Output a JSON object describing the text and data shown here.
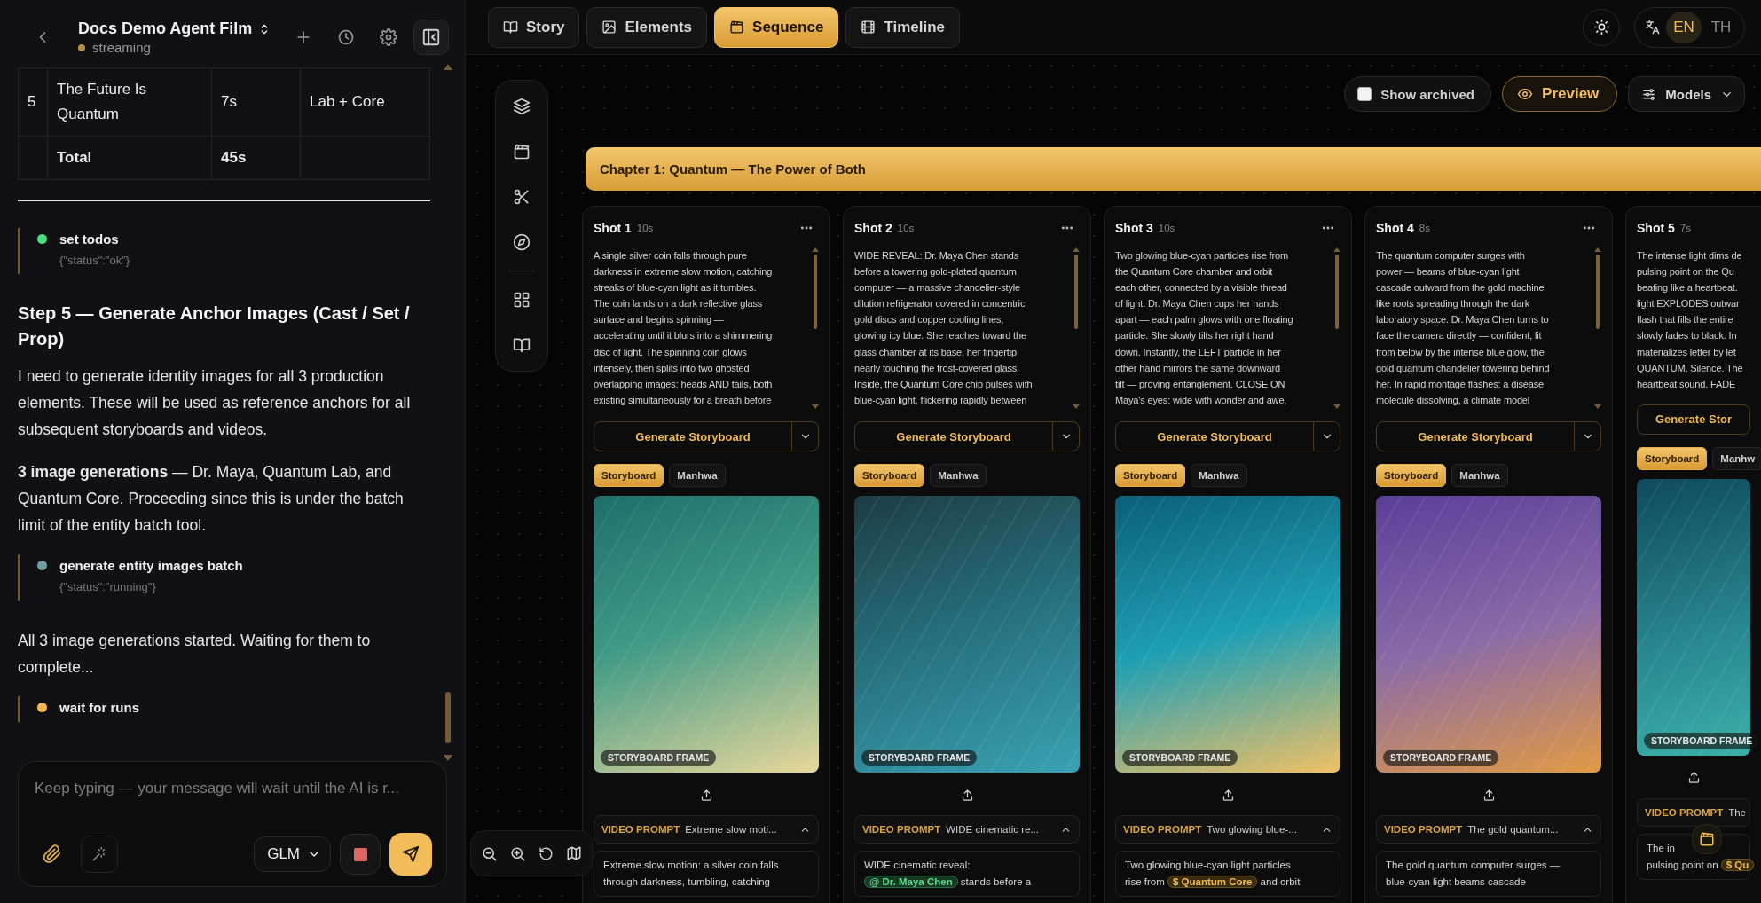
{
  "sidebar": {
    "title": "Docs Demo Agent Film",
    "status": "streaming",
    "table": {
      "rows": [
        {
          "kind": "normal",
          "column_1": "5",
          "column_2": "The Future Is Quantum",
          "column_3": "7s",
          "column_4": "Lab + Core"
        },
        {
          "kind": "total",
          "column_2": "Total",
          "column_3": "45s"
        }
      ]
    },
    "messages": [
      {
        "kind": "tool",
        "name": "set todos",
        "result": "{\"status\":\"ok\"}",
        "color": "#4ade80"
      },
      {
        "kind": "heading",
        "text": "Step 5 — Generate Anchor Images (Cast / Set / Prop)"
      },
      {
        "kind": "paragraph",
        "text": "I need to generate identity images for all 3 production elements. These will be used as reference anchors for all subsequent storyboards and videos."
      },
      {
        "kind": "paragraph",
        "text": "**3 image generations** — Dr. Maya, Quantum Lab, and Quantum Core. Proceeding since this is under the batch limit of the entity batch tool."
      },
      {
        "kind": "tool",
        "name": "generate entity images batch",
        "result": "{\"status\":\"running\"}",
        "color": "#6f9ea0"
      },
      {
        "kind": "paragraph",
        "text": "All 3 image generations started. Waiting for them to complete..."
      },
      {
        "kind": "tool",
        "name": "wait for runs",
        "color": "#f2b551"
      }
    ],
    "composer": {
      "placeholder": "Keep typing — your message will wait until the AI is r...",
      "model": "GLM"
    }
  },
  "tabs": [
    {
      "label": "Story",
      "selected": false
    },
    {
      "label": "Elements",
      "selected": false
    },
    {
      "label": "Sequence",
      "selected": true
    },
    {
      "label": "Timeline",
      "selected": false
    }
  ],
  "languages": [
    {
      "label": "EN",
      "selected": true
    },
    {
      "label": "TH",
      "selected": false
    }
  ],
  "controls": {
    "show_archived": {
      "label": "Show archived",
      "checked": false
    },
    "preview": "Preview",
    "models": "Models"
  },
  "chapter": {
    "title": "Chapter 1: Quantum — The Power of Both"
  },
  "shots": [
    {
      "title": "Shot 1",
      "duration": "10s",
      "more_menu": true,
      "description": "A single silver coin falls through pure\ndarkness in extreme slow motion, catching\nstreaks of blue-cyan light as it tumbles.\nThe coin lands on a dark reflective glass\nsurface and begins spinning —\naccelerating until it blurs into a shimmering\ndisc of light. The spinning coin glows\nintensely, then splits into two ghosted\noverlapping images: heads AND tails, both\nexisting simultaneously for a breath before",
      "generate": "Generate Storyboard",
      "modes": [
        {
          "label": "Storyboard",
          "selected": true
        },
        {
          "label": "Manhwa",
          "selected": false
        }
      ],
      "frame_label": "STORYBOARD FRAME",
      "prompt_label": "VIDEO PROMPT",
      "prompt_summary": "Extreme slow moti...",
      "prompt": [
        {
          "kind": "text",
          "text": "Extreme slow motion: a silver coin falls\nthrough darkness, tumbling, catching"
        }
      ]
    },
    {
      "title": "Shot 2",
      "duration": "10s",
      "more_menu": true,
      "description": "WIDE REVEAL: Dr. Maya Chen stands\nbefore a towering gold-plated quantum\ncomputer — a massive chandelier-style\ndilution refrigerator covered in concentric\ngold discs and copper cooling lines,\nglowing icy blue. She reaches toward the\nglass chamber at its base, her fingertip\nnearly touching the frost-covered glass.\nInside, the Quantum Core chip pulses with\nblue-cyan light, flickering rapidly between",
      "generate": "Generate Storyboard",
      "modes": [
        {
          "label": "Storyboard",
          "selected": true
        },
        {
          "label": "Manhwa",
          "selected": false
        }
      ],
      "frame_label": "STORYBOARD FRAME",
      "prompt_label": "VIDEO PROMPT",
      "prompt_summary": "WIDE cinematic re...",
      "prompt": [
        {
          "kind": "text",
          "text": "WIDE cinematic reveal:\n"
        },
        {
          "kind": "cast",
          "text": "@ Dr. Maya Chen"
        },
        {
          "kind": "text",
          "text": " stands before a"
        }
      ]
    },
    {
      "title": "Shot 3",
      "duration": "10s",
      "more_menu": true,
      "description": "Two glowing blue-cyan particles rise from\nthe Quantum Core chamber and orbit\neach other, connected by a visible thread\nof light. Dr. Maya Chen cups her hands\napart — each palm glows with one floating\nparticle. She slowly tilts her right hand\ndown. Instantly, the LEFT particle in her\nother hand mirrors the same downward\ntilt — proving entanglement. CLOSE ON\nMaya's eyes: wide with wonder and awe,",
      "generate": "Generate Storyboard",
      "modes": [
        {
          "label": "Storyboard",
          "selected": true
        },
        {
          "label": "Manhwa",
          "selected": false
        }
      ],
      "frame_label": "STORYBOARD FRAME",
      "prompt_label": "VIDEO PROMPT",
      "prompt_summary": "Two glowing blue-...",
      "prompt": [
        {
          "kind": "text",
          "text": "Two glowing blue-cyan light particles\nrise from "
        },
        {
          "kind": "prop",
          "text": "$ Quantum Core"
        },
        {
          "kind": "text",
          "text": " and orbit"
        }
      ]
    },
    {
      "title": "Shot 4",
      "duration": "8s",
      "more_menu": true,
      "description": "The quantum computer surges with\npower — beams of blue-cyan light\ncascade outward from the gold machine\nlike roots spreading through the dark\nlaboratory space. Dr. Maya Chen turns to\nface the camera directly — confident, lit\nfrom below by the intense blue glow, the\ngold quantum chandelier towering behind\nher. In rapid montage flashes: a disease\nmolecule dissolving, a climate model",
      "generate": "Generate Storyboard",
      "modes": [
        {
          "label": "Storyboard",
          "selected": true
        },
        {
          "label": "Manhwa",
          "selected": false
        }
      ],
      "frame_label": "STORYBOARD FRAME",
      "prompt_label": "VIDEO PROMPT",
      "prompt_summary": "The gold quantum...",
      "prompt": [
        {
          "kind": "text",
          "text": "The gold quantum computer surges —\nblue-cyan light beams cascade"
        }
      ]
    },
    {
      "title": "Shot 5",
      "duration": "7s",
      "more_menu": false,
      "description": "The intense light dims de\npulsing point on the Qu\nbeating like a heartbeat.\nlight EXPLODES outwar\nflash that fills the entire\nslowly fades to black. In\nmaterializes letter by let\nQUANTUM. Silence. The\nheartbeat sound. FADE",
      "generate": "Generate Stor",
      "modes": [
        {
          "label": "Storyboard",
          "selected": true
        },
        {
          "label": "Manhw",
          "selected": false
        }
      ],
      "frame_label": "STORYBOARD FRAME",
      "prompt_label": "VIDEO PROMPT",
      "prompt_summary": "The",
      "prompt": [
        {
          "kind": "text",
          "text": "The in\npulsing point on "
        },
        {
          "kind": "prop",
          "text": "$ Qu"
        }
      ]
    }
  ]
}
